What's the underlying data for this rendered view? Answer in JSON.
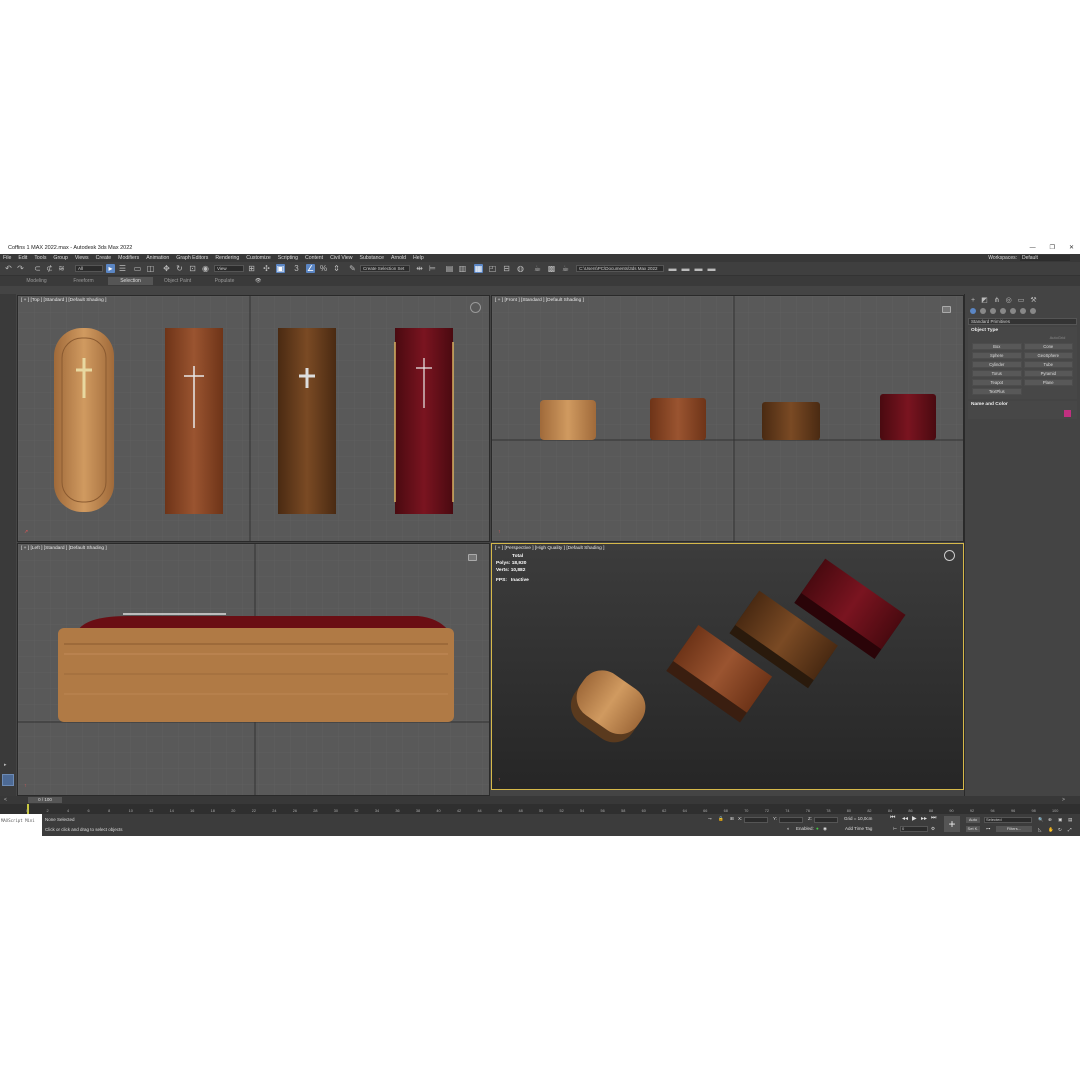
{
  "window": {
    "title": "Coffins 1 MAX 2022.max - Autodesk 3ds Max 2022",
    "minimize": "—",
    "restore": "❐",
    "close": "✕"
  },
  "menu": [
    "File",
    "Edit",
    "Tools",
    "Group",
    "Views",
    "Create",
    "Modifiers",
    "Animation",
    "Graph Editors",
    "Rendering",
    "Customize",
    "Scripting",
    "Content",
    "Civil View",
    "Substance",
    "Arnold",
    "Help"
  ],
  "workspace": {
    "label": "Workspaces:",
    "value": "Default"
  },
  "toolbar": {
    "filter": "All",
    "refcoord": "View",
    "selection_set": "Create Selection Set",
    "path": "C:\\Users\\PC\\Documents\\3ds Max 2022"
  },
  "ribbon": {
    "tabs": [
      "Modeling",
      "Freeform",
      "Selection",
      "Object Paint",
      "Populate"
    ],
    "active": 2
  },
  "viewports": {
    "top": {
      "label": "[ + ] [Top ] [Standard ] [Default Shading ]"
    },
    "front": {
      "label": "[ + ] [Front ] [Standard ] [Default Shading ]"
    },
    "left": {
      "label": "[ + ] [Left ] [Standard ] [Default Shading ]"
    },
    "persp": {
      "label": "[ + ] [Perspective ] [High Quality ] [Default Shading ]",
      "stats_total": "Total",
      "polys_label": "Polys:",
      "polys": "18,920",
      "verts_label": "Verts:",
      "verts": "10,882",
      "fps_label": "FPS:",
      "fps": "Inactive"
    }
  },
  "command_panel": {
    "category": "Standard Primitives",
    "object_type": "Object Type",
    "autogrid": "AutoGrid",
    "primitives": [
      "Box",
      "Cone",
      "Sphere",
      "GeoSphere",
      "Cylinder",
      "Tube",
      "Torus",
      "Pyramid",
      "Teapot",
      "Plane",
      "TextPlus"
    ],
    "name_and_color": "Name and Color"
  },
  "timeline": {
    "slider": "0 / 100",
    "ticks": [
      "0",
      "2",
      "4",
      "6",
      "8",
      "10",
      "12",
      "14",
      "16",
      "18",
      "20",
      "22",
      "24",
      "26",
      "28",
      "30",
      "32",
      "34",
      "36",
      "38",
      "40",
      "42",
      "44",
      "46",
      "48",
      "50",
      "52",
      "54",
      "56",
      "58",
      "60",
      "62",
      "64",
      "66",
      "68",
      "70",
      "72",
      "74",
      "76",
      "78",
      "80",
      "82",
      "84",
      "86",
      "88",
      "90",
      "92",
      "94",
      "96",
      "98",
      "100"
    ]
  },
  "status": {
    "maxscript": "MAXScript Mini",
    "selection": "None Selected",
    "prompt": "Click or click and drag to select objects",
    "x_label": "X:",
    "y_label": "Y:",
    "z_label": "Z:",
    "grid": "Grid = 10,0cm",
    "enabled": "Enabled:",
    "add_time_tag": "Add Time Tag",
    "auto": "Auto",
    "set_k": "Set K.",
    "selected": "Selected",
    "filters": "Filters...",
    "frame": "0"
  },
  "colors": {
    "accent": "#5b86c4",
    "object_color": "#c03080",
    "persp_border": "#d6b94a"
  }
}
